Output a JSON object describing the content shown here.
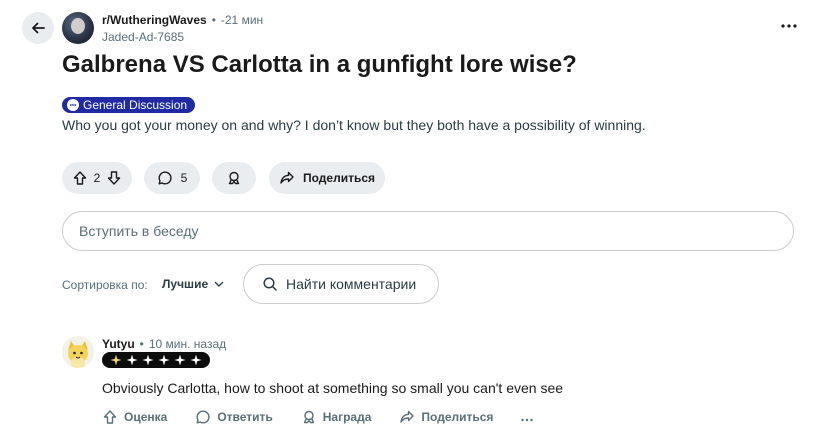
{
  "post": {
    "subreddit": "r/WutheringWaves",
    "separator": "•",
    "time": "-21 мин",
    "author": "Jaded-Ad-7685",
    "title": "Galbrena VS Carlotta in a gunfight lore wise?",
    "flair": "General Discussion",
    "body": "Who you got your money on and why? I don’t know but they both have a possibility of winning.",
    "upvotes": "2",
    "comments": "5",
    "share_label": "Поделиться"
  },
  "comment_box": {
    "placeholder": "Вступить в беседу"
  },
  "sort": {
    "label": "Сортировка по:",
    "value": "Лучшие",
    "search_placeholder": "Найти комментарии"
  },
  "comment": {
    "username": "Yutyu",
    "separator": "•",
    "time": "10 мин. назад",
    "text": "Obviously Carlotta, how to shoot at something so small you can't even see",
    "actions": {
      "rate": "Оценка",
      "reply": "Ответить",
      "award": "Награда",
      "share": "Поделиться"
    }
  },
  "colors": {
    "flair_bg": "#1f2aa3",
    "pill_bg": "#eaedef",
    "muted_text": "#576f76"
  }
}
